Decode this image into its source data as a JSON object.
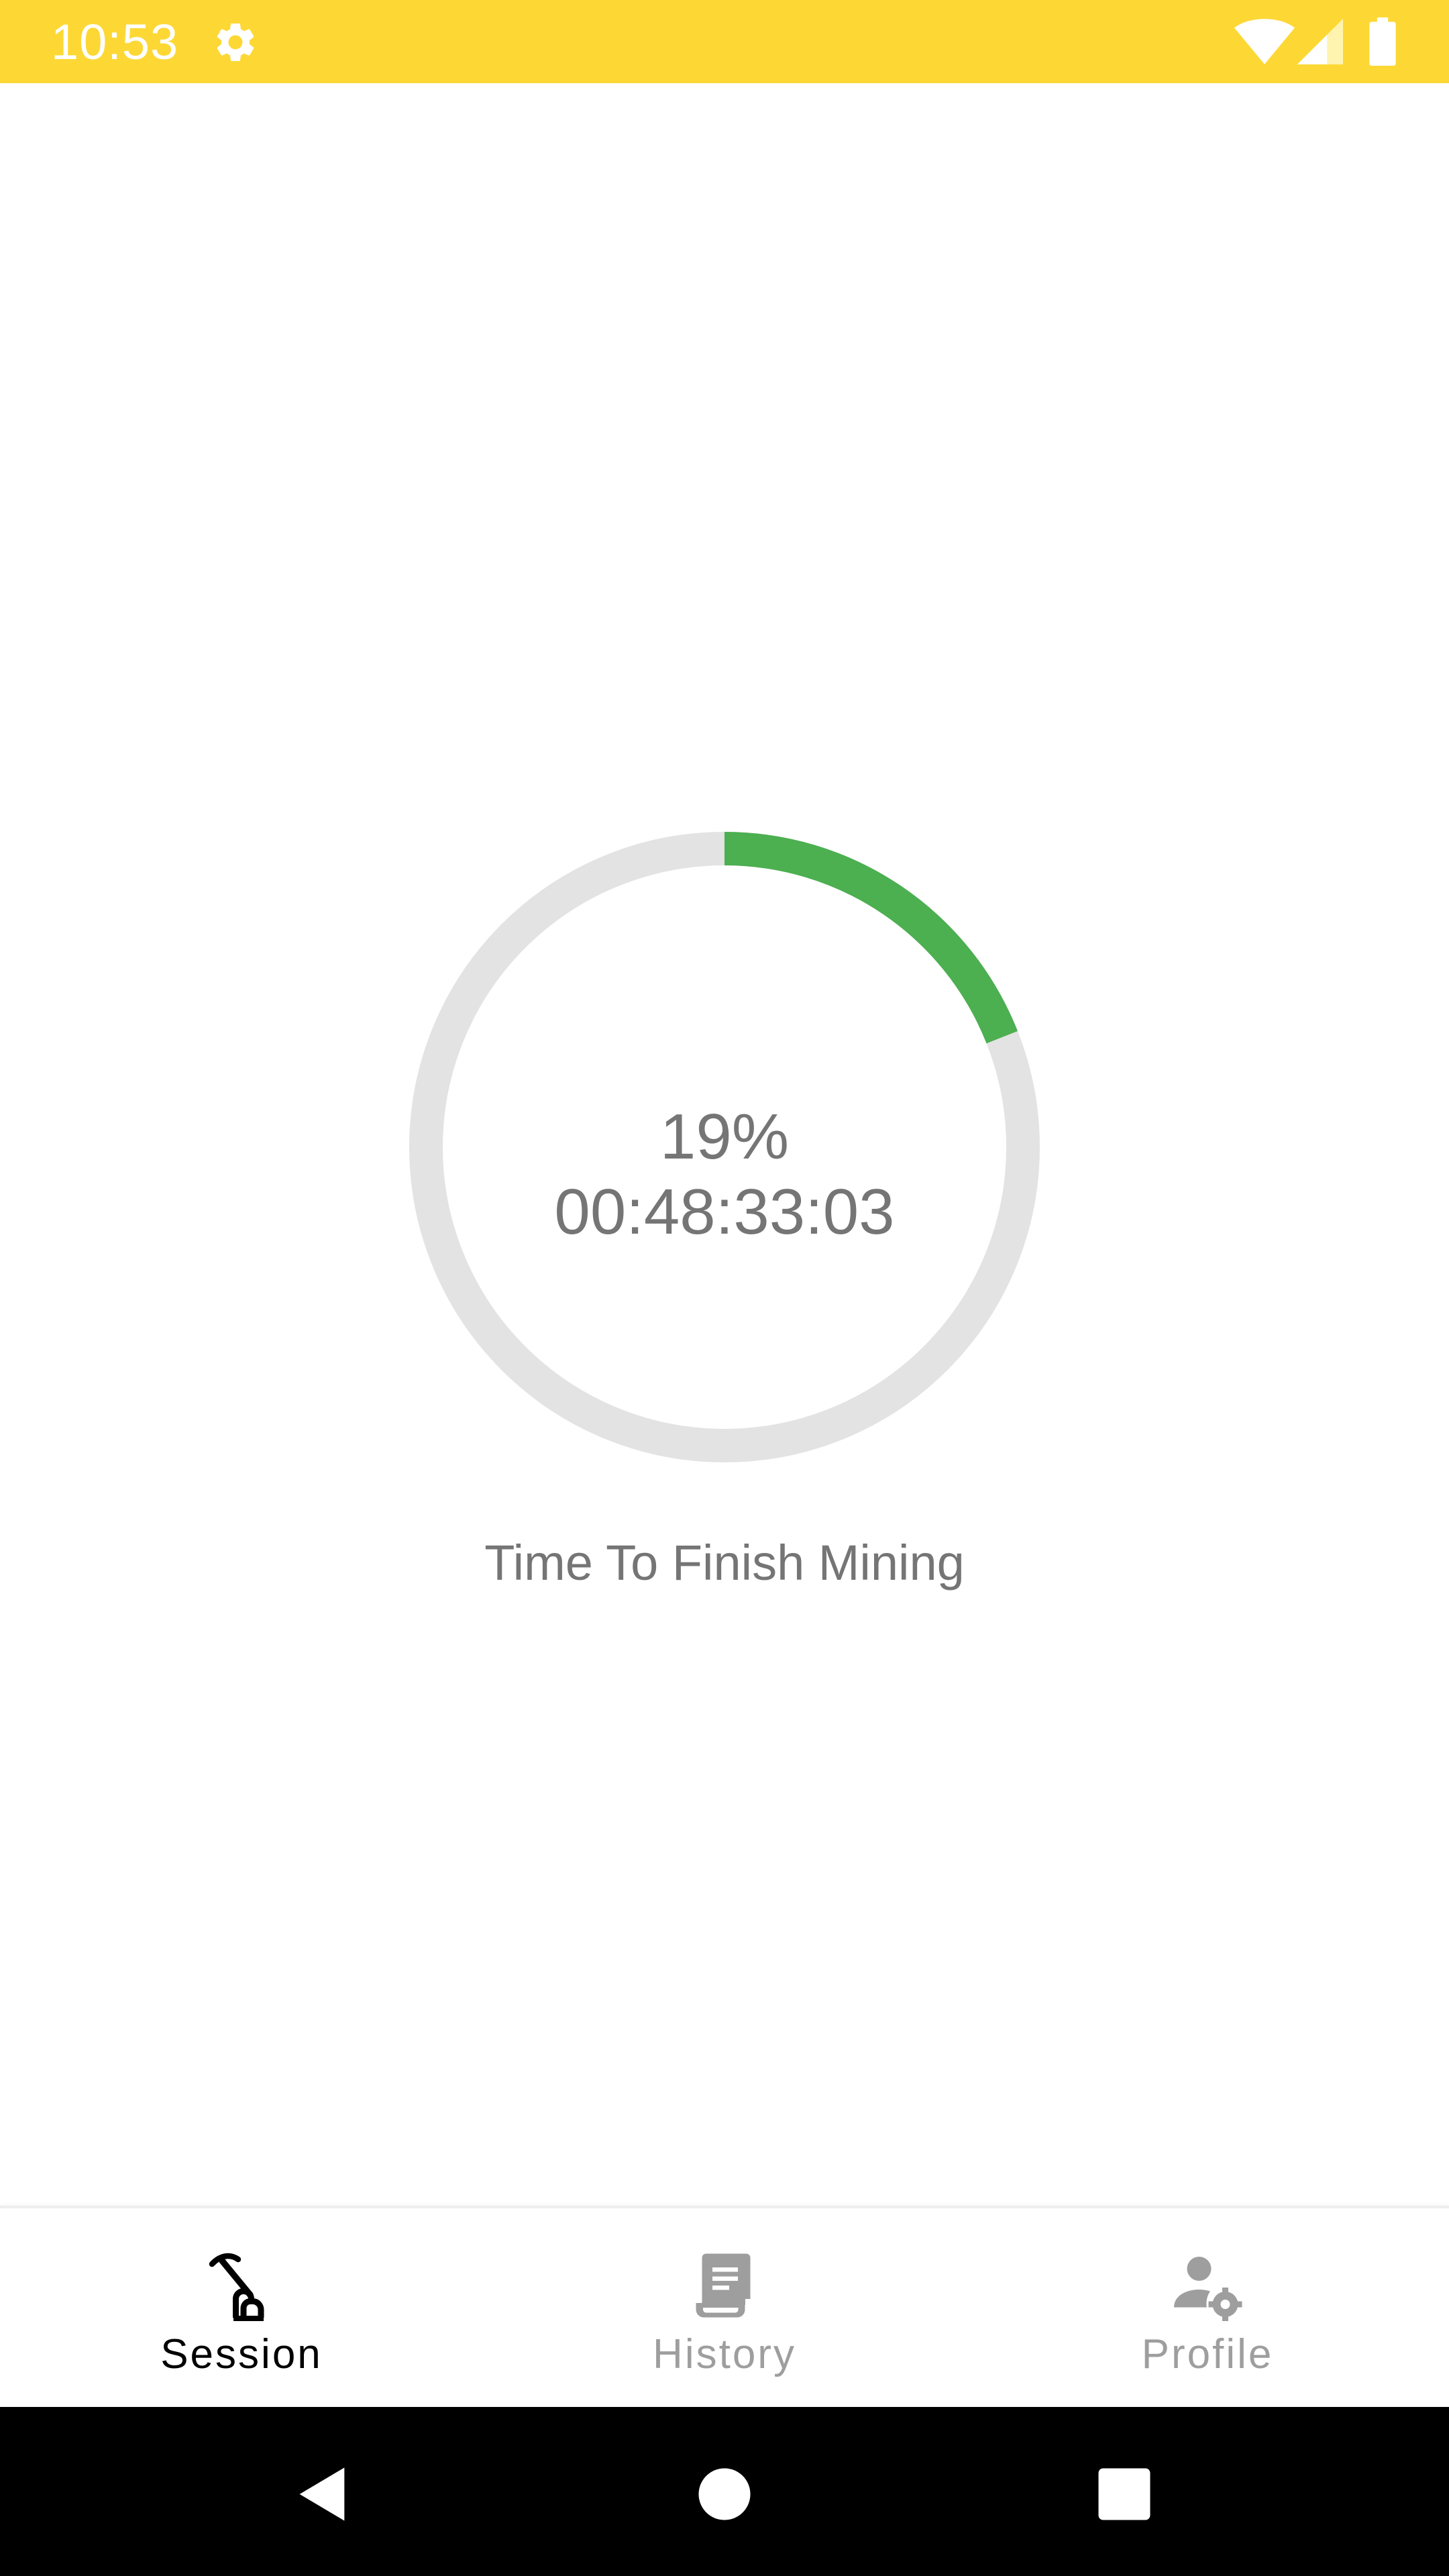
{
  "status_bar": {
    "time": "10:53",
    "background_color": "#FDD835",
    "icons": [
      "gear-icon",
      "wifi-icon",
      "signal-icon",
      "battery-icon"
    ]
  },
  "session": {
    "progress_percent": "19%",
    "progress_value": 0.19,
    "timer": "00:48:33:03",
    "caption": "Time To Finish Mining",
    "progress_color": "#4CAF50",
    "track_color": "#E3E3E3"
  },
  "bottom_nav": {
    "items": [
      {
        "label": "Session",
        "icon": "pickaxe-icon",
        "active": true
      },
      {
        "label": "History",
        "icon": "receipt-icon",
        "active": false
      },
      {
        "label": "Profile",
        "icon": "user-settings-icon",
        "active": false
      }
    ]
  },
  "system_nav": {
    "icons": [
      "back-icon",
      "home-icon",
      "recents-icon"
    ]
  }
}
